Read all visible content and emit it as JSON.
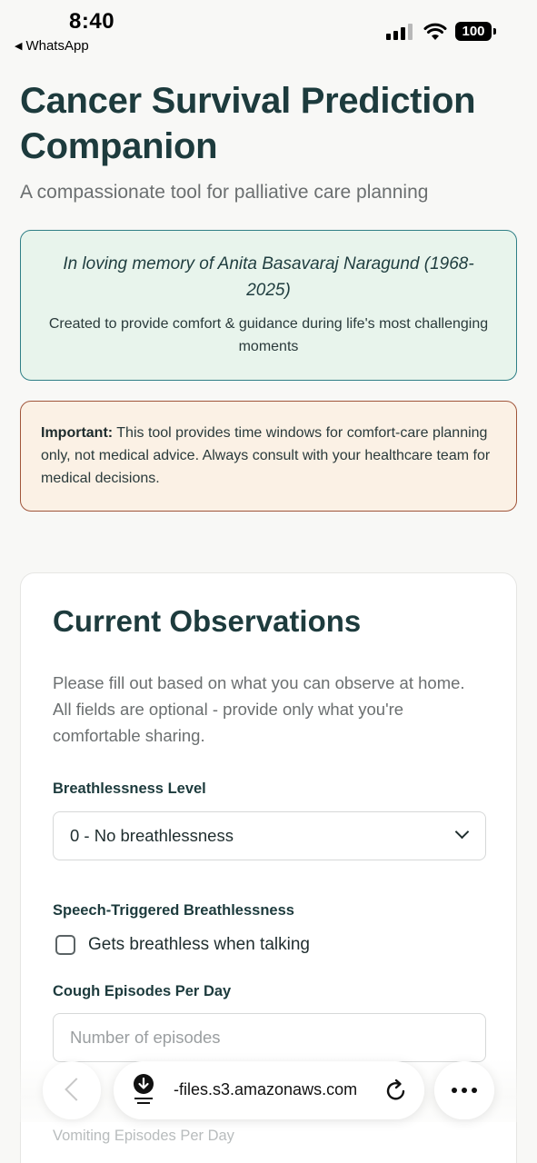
{
  "status_bar": {
    "time": "8:40",
    "back_app": "WhatsApp",
    "battery": "100"
  },
  "header": {
    "title": "Cancer Survival Prediction Companion",
    "subtitle": "A compassionate tool for palliative care planning"
  },
  "memory": {
    "dedication": "In loving memory of Anita Basavaraj Naragund (1968-2025)",
    "message": "Created to provide comfort & guidance during life's most challenging moments"
  },
  "important": {
    "label": "Important:",
    "text": " This tool provides time windows for comfort-care planning only, not medical advice. Always consult with your healthcare team for medical decisions."
  },
  "observations": {
    "title": "Current Observations",
    "intro": "Please fill out based on what you can observe at home. All fields are optional - provide only what you're comfortable sharing.",
    "breathlessness": {
      "label": "Breathlessness Level",
      "selected": "0 - No breathlessness"
    },
    "speech": {
      "label": "Speech-Triggered Breathlessness",
      "checkbox_label": "Gets breathless when talking",
      "checked": false
    },
    "cough": {
      "label": "Cough Episodes Per Day",
      "placeholder": "Number of episodes"
    },
    "vomiting": {
      "label": "Vomiting Episodes Per Day"
    }
  },
  "browser": {
    "url": "-files.s3.amazonaws.com"
  }
}
